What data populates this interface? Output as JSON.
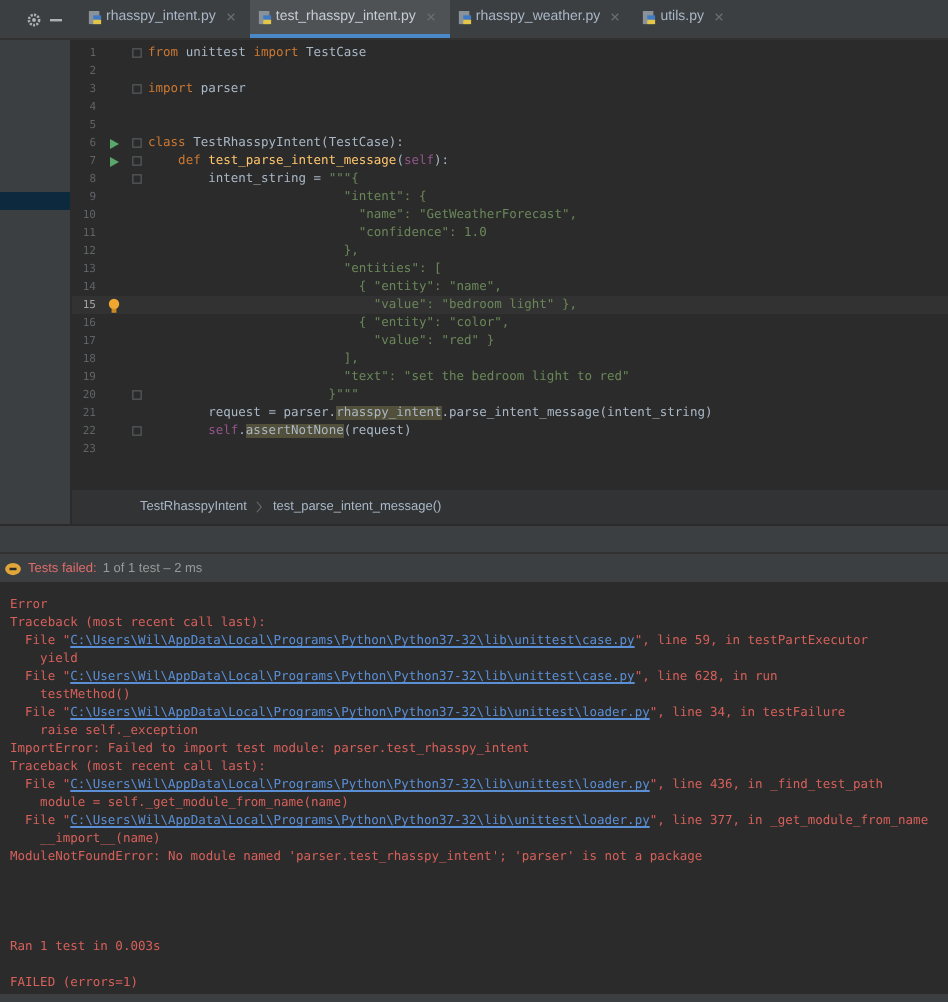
{
  "tabs": [
    {
      "label": "rhasspy_intent.py",
      "selected": false
    },
    {
      "label": "test_rhasspy_intent.py",
      "selected": true
    },
    {
      "label": "rhasspy_weather.py",
      "selected": false
    },
    {
      "label": "utils.py",
      "selected": false
    }
  ],
  "editor": {
    "lines": [
      {
        "number": "1",
        "segments": [
          {
            "kind": "kw",
            "text": "from"
          },
          {
            "kind": "plain",
            "text": " unittest "
          },
          {
            "kind": "kw",
            "text": "import"
          },
          {
            "kind": "plain",
            "text": " TestCase"
          }
        ],
        "fold": true
      },
      {
        "number": "2"
      },
      {
        "number": "3",
        "segments": [
          {
            "kind": "kw",
            "text": "import"
          },
          {
            "kind": "plain",
            "text": " parser"
          }
        ],
        "fold": true
      },
      {
        "number": "4"
      },
      {
        "number": "5"
      },
      {
        "number": "6",
        "segments": [
          {
            "kind": "kw",
            "text": "class"
          },
          {
            "kind": "plain",
            "text": " TestRhasspyIntent(TestCase):"
          }
        ],
        "run": true,
        "fold": true
      },
      {
        "number": "7",
        "segments": [
          {
            "kind": "kw",
            "text": "    def"
          },
          {
            "kind": "def",
            "text": " test_parse_intent_message"
          },
          {
            "kind": "plain",
            "text": "("
          },
          {
            "kind": "self",
            "text": "self"
          },
          {
            "kind": "plain",
            "text": "):"
          }
        ],
        "run": true,
        "fold": true
      },
      {
        "number": "8",
        "segments": [
          {
            "kind": "plain",
            "text": "        intent_string = "
          },
          {
            "kind": "str",
            "text": "\"\"\"{"
          }
        ],
        "fold": true
      },
      {
        "number": "9",
        "segments": [
          {
            "kind": "str",
            "text": "                          \"intent\": {"
          }
        ]
      },
      {
        "number": "10",
        "segments": [
          {
            "kind": "str",
            "text": "                            \"name\": \"GetWeatherForecast\","
          }
        ]
      },
      {
        "number": "11",
        "segments": [
          {
            "kind": "str",
            "text": "                            \"confidence\": 1.0"
          }
        ]
      },
      {
        "number": "12",
        "segments": [
          {
            "kind": "str",
            "text": "                          },"
          }
        ]
      },
      {
        "number": "13",
        "segments": [
          {
            "kind": "str",
            "text": "                          \"entities\": ["
          }
        ]
      },
      {
        "number": "14",
        "segments": [
          {
            "kind": "str",
            "text": "                            { \"entity\": \"name\","
          }
        ]
      },
      {
        "number": "15",
        "segments": [
          {
            "kind": "str",
            "text": "                              \"value\": \"bedroom light\" },"
          }
        ],
        "bulb": true,
        "current": true
      },
      {
        "number": "16",
        "segments": [
          {
            "kind": "str",
            "text": "                            { \"entity\": \"color\","
          }
        ]
      },
      {
        "number": "17",
        "segments": [
          {
            "kind": "str",
            "text": "                              \"value\": \"red\" }"
          }
        ]
      },
      {
        "number": "18",
        "segments": [
          {
            "kind": "str",
            "text": "                          ],"
          }
        ]
      },
      {
        "number": "19",
        "segments": [
          {
            "kind": "str",
            "text": "                          \"text\": \"set the bedroom light to red\""
          }
        ]
      },
      {
        "number": "20",
        "segments": [
          {
            "kind": "str",
            "text": "                        }\"\"\""
          }
        ],
        "fold": true
      },
      {
        "number": "21",
        "segments": [
          {
            "kind": "plain",
            "text": "        request = parser."
          },
          {
            "kind": "warn",
            "text": "rhasspy_intent"
          },
          {
            "kind": "plain",
            "text": ".parse_intent_message(intent_string)"
          }
        ]
      },
      {
        "number": "22",
        "segments": [
          {
            "kind": "self",
            "text": "        self"
          },
          {
            "kind": "plain",
            "text": "."
          },
          {
            "kind": "warn",
            "text": "assertNotNone"
          },
          {
            "kind": "plain",
            "text": "(request)"
          }
        ],
        "fold": true
      },
      {
        "number": "23"
      }
    ]
  },
  "breadcrumbs": [
    "TestRhasspyIntent",
    "test_parse_intent_message()"
  ],
  "test_status": {
    "failed_label": "Tests failed:",
    "detail": "1 of 1 test – 2 ms"
  },
  "console": {
    "lines": [
      [
        {
          "kind": "text",
          "text": "Error"
        }
      ],
      [
        {
          "kind": "text",
          "text": "Traceback (most recent call last):"
        }
      ],
      [
        {
          "kind": "text",
          "text": "  File \""
        },
        {
          "kind": "link",
          "text": "C:\\Users\\Wil\\AppData\\Local\\Programs\\Python\\Python37-32\\lib\\unittest\\case.py"
        },
        {
          "kind": "text",
          "text": "\", line 59, in testPartExecutor"
        }
      ],
      [
        {
          "kind": "text",
          "text": "    yield"
        }
      ],
      [
        {
          "kind": "text",
          "text": "  File \""
        },
        {
          "kind": "link",
          "text": "C:\\Users\\Wil\\AppData\\Local\\Programs\\Python\\Python37-32\\lib\\unittest\\case.py"
        },
        {
          "kind": "text",
          "text": "\", line 628, in run"
        }
      ],
      [
        {
          "kind": "text",
          "text": "    testMethod()"
        }
      ],
      [
        {
          "kind": "text",
          "text": "  File \""
        },
        {
          "kind": "link",
          "text": "C:\\Users\\Wil\\AppData\\Local\\Programs\\Python\\Python37-32\\lib\\unittest\\loader.py"
        },
        {
          "kind": "text",
          "text": "\", line 34, in testFailure"
        }
      ],
      [
        {
          "kind": "text",
          "text": "    raise self._exception"
        }
      ],
      [
        {
          "kind": "text",
          "text": "ImportError: Failed to import test module: parser.test_rhasspy_intent"
        }
      ],
      [
        {
          "kind": "text",
          "text": "Traceback (most recent call last):"
        }
      ],
      [
        {
          "kind": "text",
          "text": "  File \""
        },
        {
          "kind": "link",
          "text": "C:\\Users\\Wil\\AppData\\Local\\Programs\\Python\\Python37-32\\lib\\unittest\\loader.py"
        },
        {
          "kind": "text",
          "text": "\", line 436, in _find_test_path"
        }
      ],
      [
        {
          "kind": "text",
          "text": "    module = self._get_module_from_name(name)"
        }
      ],
      [
        {
          "kind": "text",
          "text": "  File \""
        },
        {
          "kind": "link",
          "text": "C:\\Users\\Wil\\AppData\\Local\\Programs\\Python\\Python37-32\\lib\\unittest\\loader.py"
        },
        {
          "kind": "text",
          "text": "\", line 377, in _get_module_from_name"
        }
      ],
      [
        {
          "kind": "text",
          "text": "    __import__(name)"
        }
      ],
      [
        {
          "kind": "text",
          "text": "ModuleNotFoundError: No module named 'parser.test_rhasspy_intent'; 'parser' is not a package"
        }
      ]
    ],
    "summary": [
      "Ran 1 test in 0.003s",
      "FAILED (errors=1)"
    ]
  }
}
